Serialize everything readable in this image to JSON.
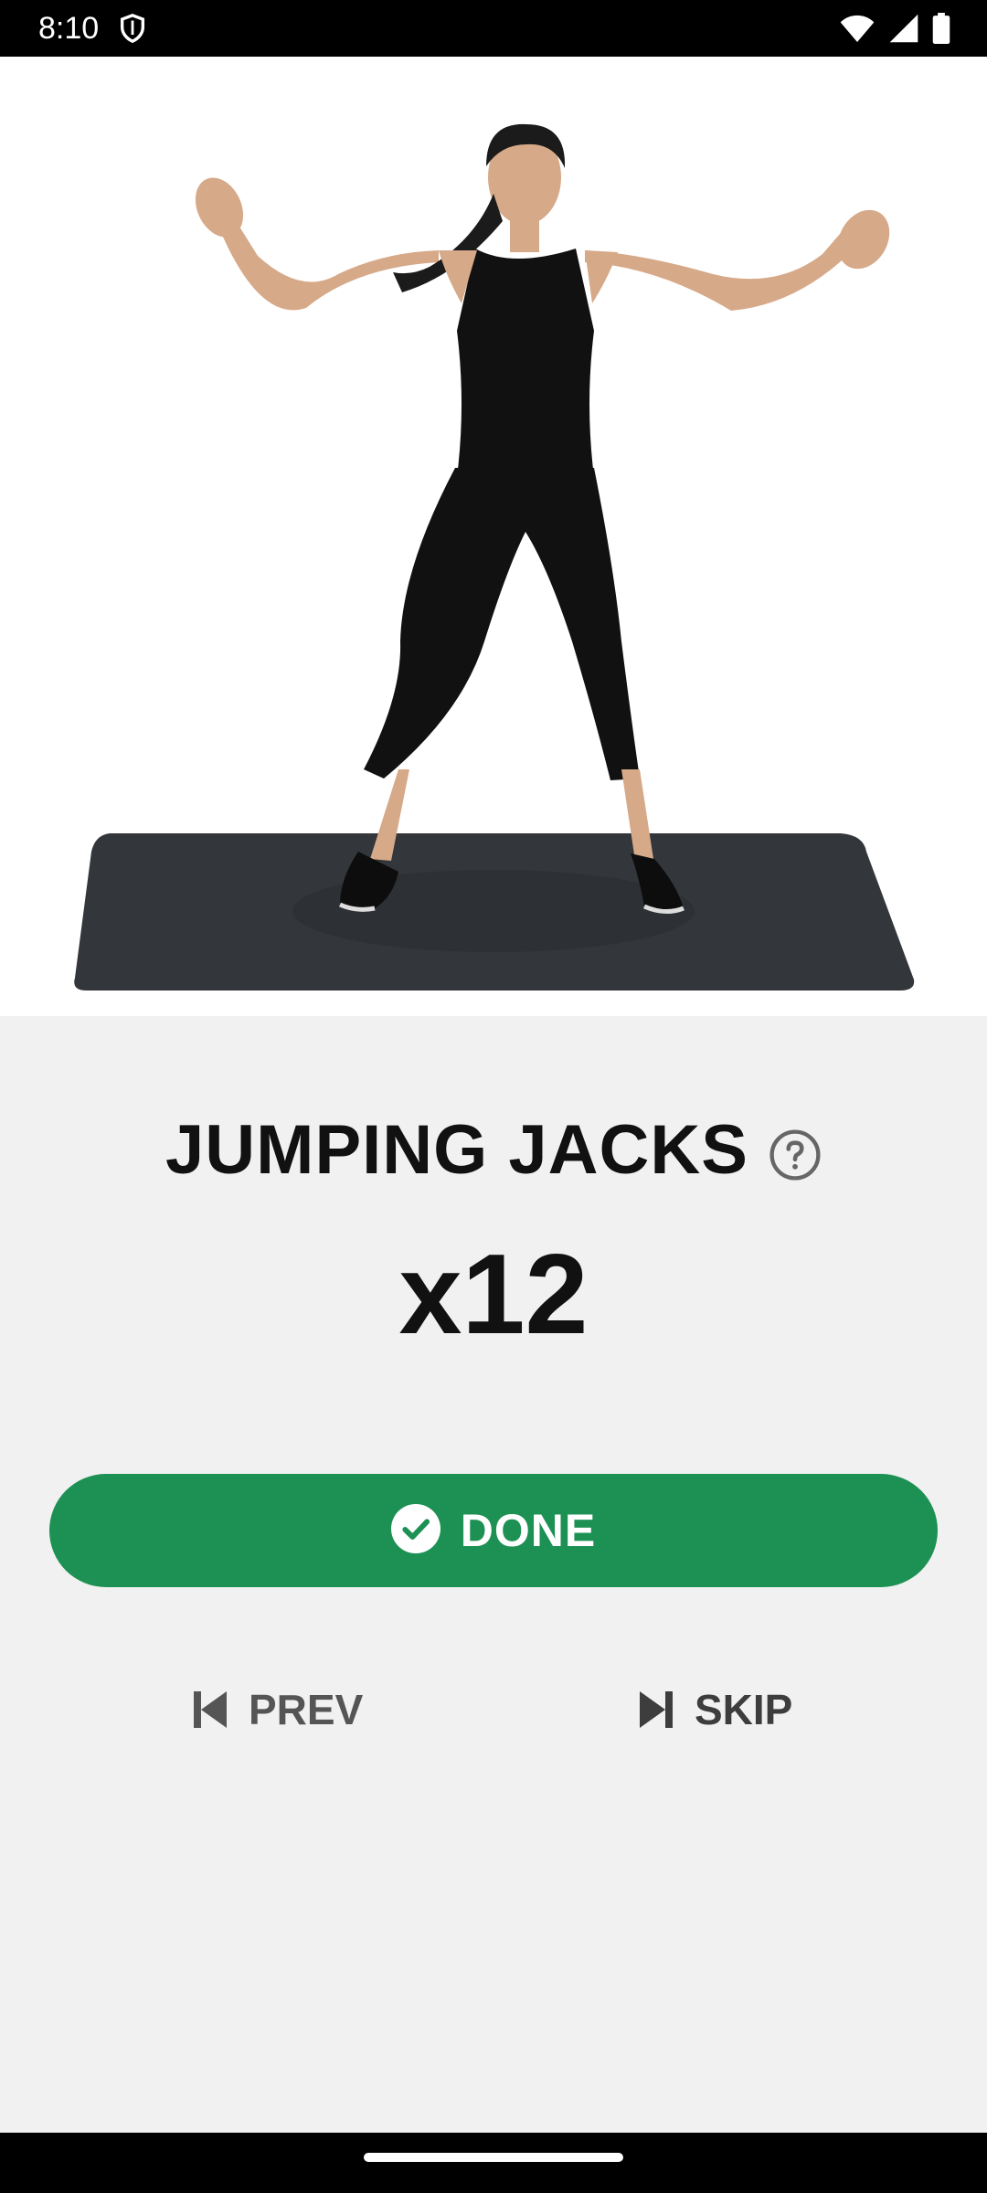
{
  "status_bar": {
    "time": "8:10",
    "icons": [
      "shield-icon",
      "wifi-icon",
      "signal-icon",
      "battery-icon"
    ]
  },
  "media": {
    "icon": "exercise-animation"
  },
  "exercise": {
    "title": "JUMPING JACKS",
    "reps": "x12",
    "help_icon": "help-circle-icon"
  },
  "actions": {
    "done_label": "DONE",
    "prev_label": "PREV",
    "skip_label": "SKIP"
  },
  "colors": {
    "accent": "#1c9153",
    "background": "#f1f1f1",
    "secondary_text": "#555555"
  }
}
